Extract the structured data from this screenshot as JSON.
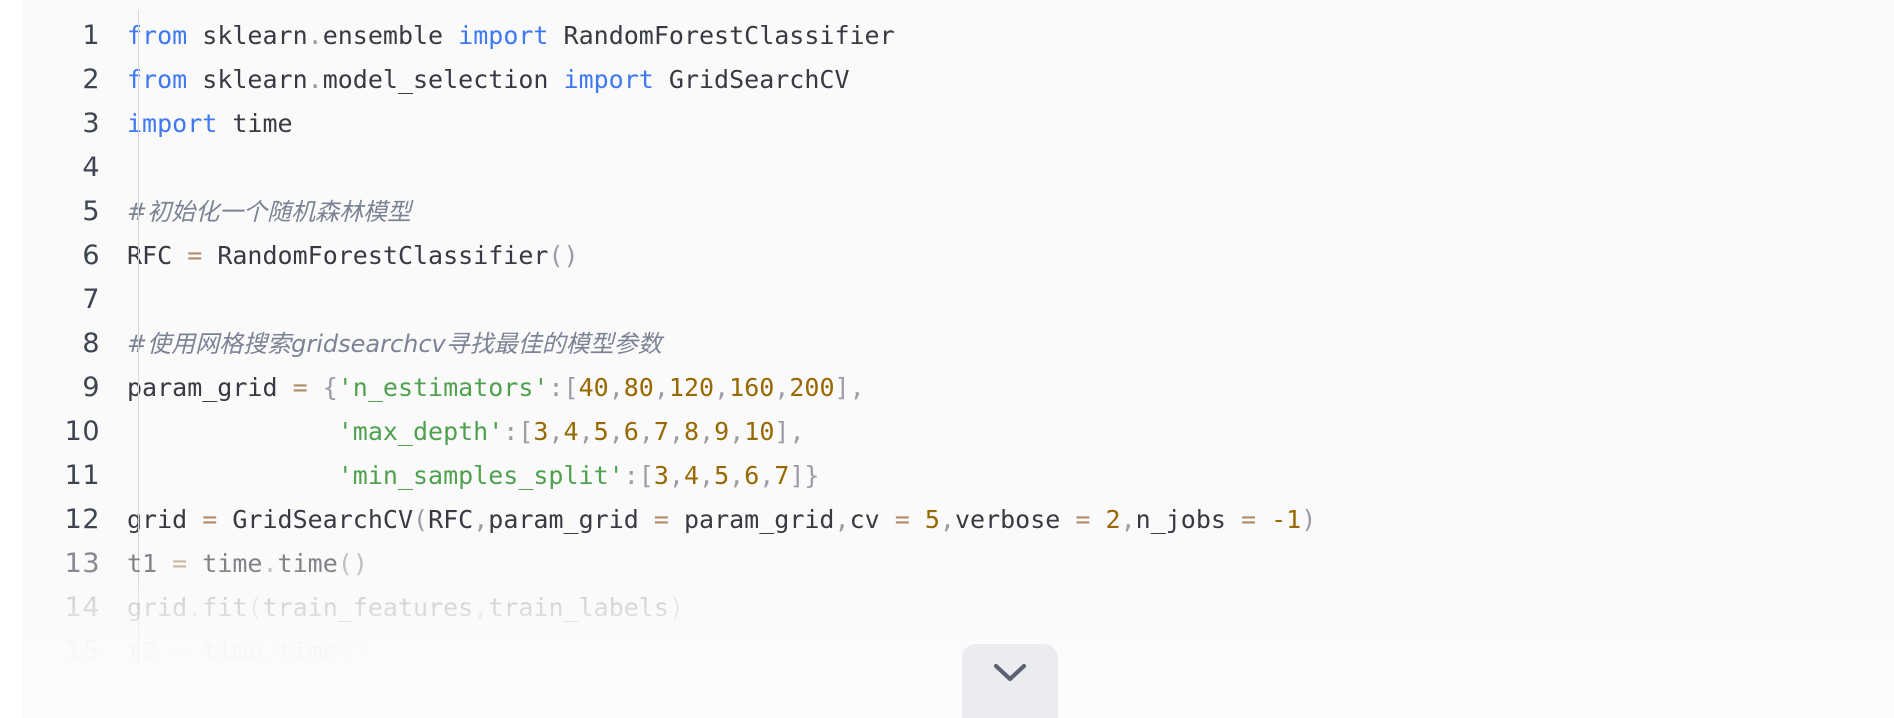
{
  "code_block": {
    "language": "python",
    "theme_colors": {
      "background": "#fafafa",
      "page_background": "#ffffff",
      "default_text": "#383a42",
      "keyword": "#4078f2",
      "string": "#50a14f",
      "number": "#986801",
      "operator": "#b08b6a",
      "punctuation": "#9a9ca3",
      "comment": "#7b8394",
      "line_number": "#3f4451",
      "gutter_rule": "#d5d7db",
      "expand_button": "#ebecf0",
      "chevron": "#5c6070"
    },
    "line_numbers": [
      "1",
      "2",
      "3",
      "4",
      "5",
      "6",
      "7",
      "8",
      "9",
      "10",
      "11",
      "12",
      "13",
      "14",
      "15"
    ],
    "lines": [
      {
        "number": "1",
        "plain": "from sklearn.ensemble import RandomForestClassifier",
        "tokens": [
          {
            "t": "from",
            "c": "kw"
          },
          {
            "t": " sklearn",
            "c": "id"
          },
          {
            "t": ".",
            "c": "punc"
          },
          {
            "t": "ensemble ",
            "c": "id"
          },
          {
            "t": "import",
            "c": "kw"
          },
          {
            "t": " RandomForestClassifier",
            "c": "id"
          }
        ]
      },
      {
        "number": "2",
        "plain": "from sklearn.model_selection import GridSearchCV",
        "tokens": [
          {
            "t": "from",
            "c": "kw"
          },
          {
            "t": " sklearn",
            "c": "id"
          },
          {
            "t": ".",
            "c": "punc"
          },
          {
            "t": "model_selection ",
            "c": "id"
          },
          {
            "t": "import",
            "c": "kw"
          },
          {
            "t": " GridSearchCV",
            "c": "id"
          }
        ]
      },
      {
        "number": "3",
        "plain": "import time",
        "tokens": [
          {
            "t": "import",
            "c": "kw"
          },
          {
            "t": " time",
            "c": "id"
          }
        ]
      },
      {
        "number": "4",
        "plain": "",
        "tokens": []
      },
      {
        "number": "5",
        "plain": "#初始化一个随机森林模型",
        "tokens": [
          {
            "t": "#初始化一个随机森林模型",
            "c": "cmt"
          }
        ]
      },
      {
        "number": "6",
        "plain": "RFC = RandomForestClassifier()",
        "tokens": [
          {
            "t": "RFC ",
            "c": "id"
          },
          {
            "t": "=",
            "c": "op"
          },
          {
            "t": " RandomForestClassifier",
            "c": "id"
          },
          {
            "t": "()",
            "c": "punc"
          }
        ]
      },
      {
        "number": "7",
        "plain": "",
        "tokens": []
      },
      {
        "number": "8",
        "plain": "#使用网格搜索gridsearchcv寻找最佳的模型参数",
        "tokens": [
          {
            "t": "#使用网格搜索gridsearchcv寻找最佳的模型参数",
            "c": "cmt"
          }
        ]
      },
      {
        "number": "9",
        "plain": "param_grid = {'n_estimators':[40,80,120,160,200],",
        "tokens": [
          {
            "t": "param_grid ",
            "c": "id"
          },
          {
            "t": "=",
            "c": "op"
          },
          {
            "t": " {",
            "c": "punc"
          },
          {
            "t": "'n_estimators'",
            "c": "str"
          },
          {
            "t": ":[",
            "c": "punc"
          },
          {
            "t": "40",
            "c": "num"
          },
          {
            "t": ",",
            "c": "punc"
          },
          {
            "t": "80",
            "c": "num"
          },
          {
            "t": ",",
            "c": "punc"
          },
          {
            "t": "120",
            "c": "num"
          },
          {
            "t": ",",
            "c": "punc"
          },
          {
            "t": "160",
            "c": "num"
          },
          {
            "t": ",",
            "c": "punc"
          },
          {
            "t": "200",
            "c": "num"
          },
          {
            "t": "],",
            "c": "punc"
          }
        ]
      },
      {
        "number": "10",
        "plain": "              'max_depth':[3,4,5,6,7,8,9,10],",
        "tokens": [
          {
            "t": "              ",
            "c": "id"
          },
          {
            "t": "'max_depth'",
            "c": "str"
          },
          {
            "t": ":[",
            "c": "punc"
          },
          {
            "t": "3",
            "c": "num"
          },
          {
            "t": ",",
            "c": "punc"
          },
          {
            "t": "4",
            "c": "num"
          },
          {
            "t": ",",
            "c": "punc"
          },
          {
            "t": "5",
            "c": "num"
          },
          {
            "t": ",",
            "c": "punc"
          },
          {
            "t": "6",
            "c": "num"
          },
          {
            "t": ",",
            "c": "punc"
          },
          {
            "t": "7",
            "c": "num"
          },
          {
            "t": ",",
            "c": "punc"
          },
          {
            "t": "8",
            "c": "num"
          },
          {
            "t": ",",
            "c": "punc"
          },
          {
            "t": "9",
            "c": "num"
          },
          {
            "t": ",",
            "c": "punc"
          },
          {
            "t": "10",
            "c": "num"
          },
          {
            "t": "],",
            "c": "punc"
          }
        ]
      },
      {
        "number": "11",
        "plain": "              'min_samples_split':[3,4,5,6,7]}",
        "tokens": [
          {
            "t": "              ",
            "c": "id"
          },
          {
            "t": "'min_samples_split'",
            "c": "str"
          },
          {
            "t": ":[",
            "c": "punc"
          },
          {
            "t": "3",
            "c": "num"
          },
          {
            "t": ",",
            "c": "punc"
          },
          {
            "t": "4",
            "c": "num"
          },
          {
            "t": ",",
            "c": "punc"
          },
          {
            "t": "5",
            "c": "num"
          },
          {
            "t": ",",
            "c": "punc"
          },
          {
            "t": "6",
            "c": "num"
          },
          {
            "t": ",",
            "c": "punc"
          },
          {
            "t": "7",
            "c": "num"
          },
          {
            "t": "]}",
            "c": "punc"
          }
        ]
      },
      {
        "number": "12",
        "plain": "grid = GridSearchCV(RFC,param_grid = param_grid,cv = 5,verbose = 2,n_jobs = -1)",
        "tokens": [
          {
            "t": "grid ",
            "c": "id"
          },
          {
            "t": "=",
            "c": "op"
          },
          {
            "t": " GridSearchCV",
            "c": "id"
          },
          {
            "t": "(",
            "c": "punc"
          },
          {
            "t": "RFC",
            "c": "id"
          },
          {
            "t": ",",
            "c": "punc"
          },
          {
            "t": "param_grid ",
            "c": "id"
          },
          {
            "t": "=",
            "c": "op"
          },
          {
            "t": " param_grid",
            "c": "id"
          },
          {
            "t": ",",
            "c": "punc"
          },
          {
            "t": "cv ",
            "c": "id"
          },
          {
            "t": "=",
            "c": "op"
          },
          {
            "t": " ",
            "c": "id"
          },
          {
            "t": "5",
            "c": "num"
          },
          {
            "t": ",",
            "c": "punc"
          },
          {
            "t": "verbose ",
            "c": "id"
          },
          {
            "t": "=",
            "c": "op"
          },
          {
            "t": " ",
            "c": "id"
          },
          {
            "t": "2",
            "c": "num"
          },
          {
            "t": ",",
            "c": "punc"
          },
          {
            "t": "n_jobs ",
            "c": "id"
          },
          {
            "t": "=",
            "c": "op"
          },
          {
            "t": " ",
            "c": "id"
          },
          {
            "t": "-1",
            "c": "num"
          },
          {
            "t": ")",
            "c": "punc"
          }
        ]
      },
      {
        "number": "13",
        "plain": "t1 = time.time()",
        "tokens": [
          {
            "t": "t1 ",
            "c": "id"
          },
          {
            "t": "=",
            "c": "op"
          },
          {
            "t": " time",
            "c": "id"
          },
          {
            "t": ".",
            "c": "punc"
          },
          {
            "t": "time",
            "c": "id"
          },
          {
            "t": "()",
            "c": "punc"
          }
        ]
      },
      {
        "number": "14",
        "plain": "grid.fit(train_features,train_labels)",
        "tokens": [
          {
            "t": "grid",
            "c": "id"
          },
          {
            "t": ".",
            "c": "punc"
          },
          {
            "t": "fit",
            "c": "id"
          },
          {
            "t": "(",
            "c": "punc"
          },
          {
            "t": "train_features",
            "c": "id"
          },
          {
            "t": ",",
            "c": "punc"
          },
          {
            "t": "train_labels",
            "c": "id"
          },
          {
            "t": ")",
            "c": "punc"
          }
        ]
      },
      {
        "number": "15",
        "plain": "t2 = time.time()",
        "tokens": [
          {
            "t": "t2 ",
            "c": "id"
          },
          {
            "t": "=",
            "c": "op"
          },
          {
            "t": " time",
            "c": "id"
          },
          {
            "t": ".",
            "c": "punc"
          },
          {
            "t": "time",
            "c": "id"
          },
          {
            "t": "()",
            "c": "punc"
          }
        ]
      }
    ],
    "expand_button": {
      "icon": "chevron-down-icon",
      "label": ""
    }
  }
}
